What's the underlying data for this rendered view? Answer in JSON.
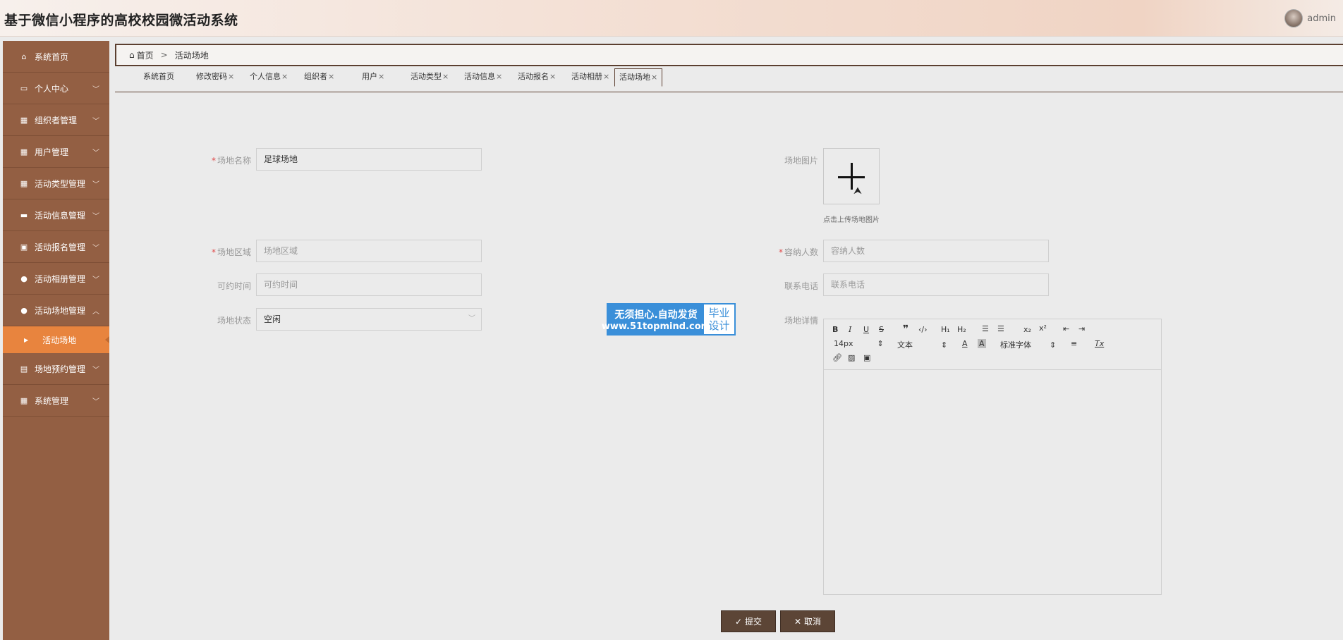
{
  "header": {
    "title": "基于微信小程序的高校校园微活动系统",
    "username": "admin"
  },
  "sidebar": {
    "items": [
      {
        "label": "系统首页",
        "icon": "home-icon"
      },
      {
        "label": "个人中心",
        "icon": "profile-icon"
      },
      {
        "label": "组织者管理",
        "icon": "grid-icon"
      },
      {
        "label": "用户管理",
        "icon": "grid-icon"
      },
      {
        "label": "活动类型管理",
        "icon": "grid-icon"
      },
      {
        "label": "活动信息管理",
        "icon": "comment-icon"
      },
      {
        "label": "活动报名管理",
        "icon": "briefcase-icon"
      },
      {
        "label": "活动相册管理",
        "icon": "user-icon"
      },
      {
        "label": "活动场地管理",
        "icon": "location-icon"
      },
      {
        "label": "场地预约管理",
        "icon": "print-icon"
      },
      {
        "label": "系统管理",
        "icon": "grid-icon"
      }
    ],
    "active_sub": "活动场地"
  },
  "breadcrumb": {
    "home": "首页",
    "separator": ">",
    "current": "活动场地"
  },
  "tabs": [
    {
      "label": "系统首页",
      "closable": false
    },
    {
      "label": "修改密码",
      "closable": true
    },
    {
      "label": "个人信息",
      "closable": true
    },
    {
      "label": "组织者",
      "closable": true
    },
    {
      "label": "用户",
      "closable": true
    },
    {
      "label": "活动类型",
      "closable": true
    },
    {
      "label": "活动信息",
      "closable": true
    },
    {
      "label": "活动报名",
      "closable": true
    },
    {
      "label": "活动相册",
      "closable": true
    },
    {
      "label": "活动场地",
      "closable": true,
      "active": true
    }
  ],
  "close_glyph": "×",
  "form": {
    "venue_name": {
      "label": "场地名称",
      "value": "足球场地"
    },
    "venue_image": {
      "label": "场地图片",
      "hint": "点击上传场地图片"
    },
    "venue_area": {
      "label": "场地区域",
      "placeholder": "场地区域"
    },
    "capacity": {
      "label": "容纳人数",
      "placeholder": "容纳人数"
    },
    "available_time": {
      "label": "可约时间",
      "placeholder": "可约时间"
    },
    "phone": {
      "label": "联系电话",
      "placeholder": "联系电话"
    },
    "status": {
      "label": "场地状态",
      "value": "空闲"
    },
    "details": {
      "label": "场地详情"
    }
  },
  "editor": {
    "font_size": "14px",
    "text_style": "文本",
    "font_family": "标准字体"
  },
  "watermark": {
    "line1": "无须担心.自动发货",
    "line2": "www.51topmind.com",
    "right1": "毕业",
    "right2": "设计"
  },
  "buttons": {
    "submit": "提交",
    "cancel": "取消"
  },
  "colors": {
    "sidebar": "#935f43",
    "active_sub": "#e8843e",
    "button": "#5c4536",
    "required": "#e04b4b"
  }
}
